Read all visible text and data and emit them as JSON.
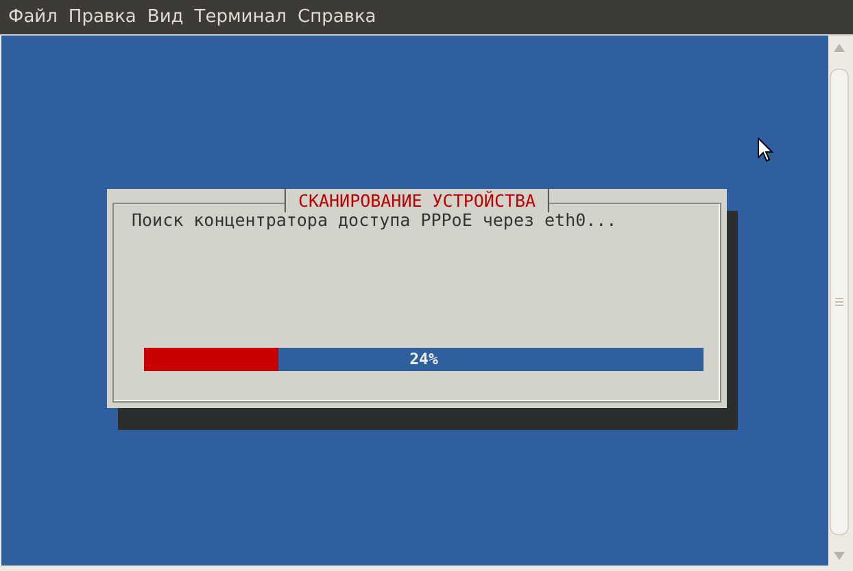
{
  "menu": [
    "Файл",
    "Правка",
    "Вид",
    "Терминал",
    "Справка"
  ],
  "dialog": {
    "title": "СКАНИРОВАНИЕ УСТРОЙСТВА",
    "message": "Поиск концентратора доступа PPPoE через eth0...",
    "progress": {
      "level": 0.24,
      "reading": "24%"
    }
  }
}
